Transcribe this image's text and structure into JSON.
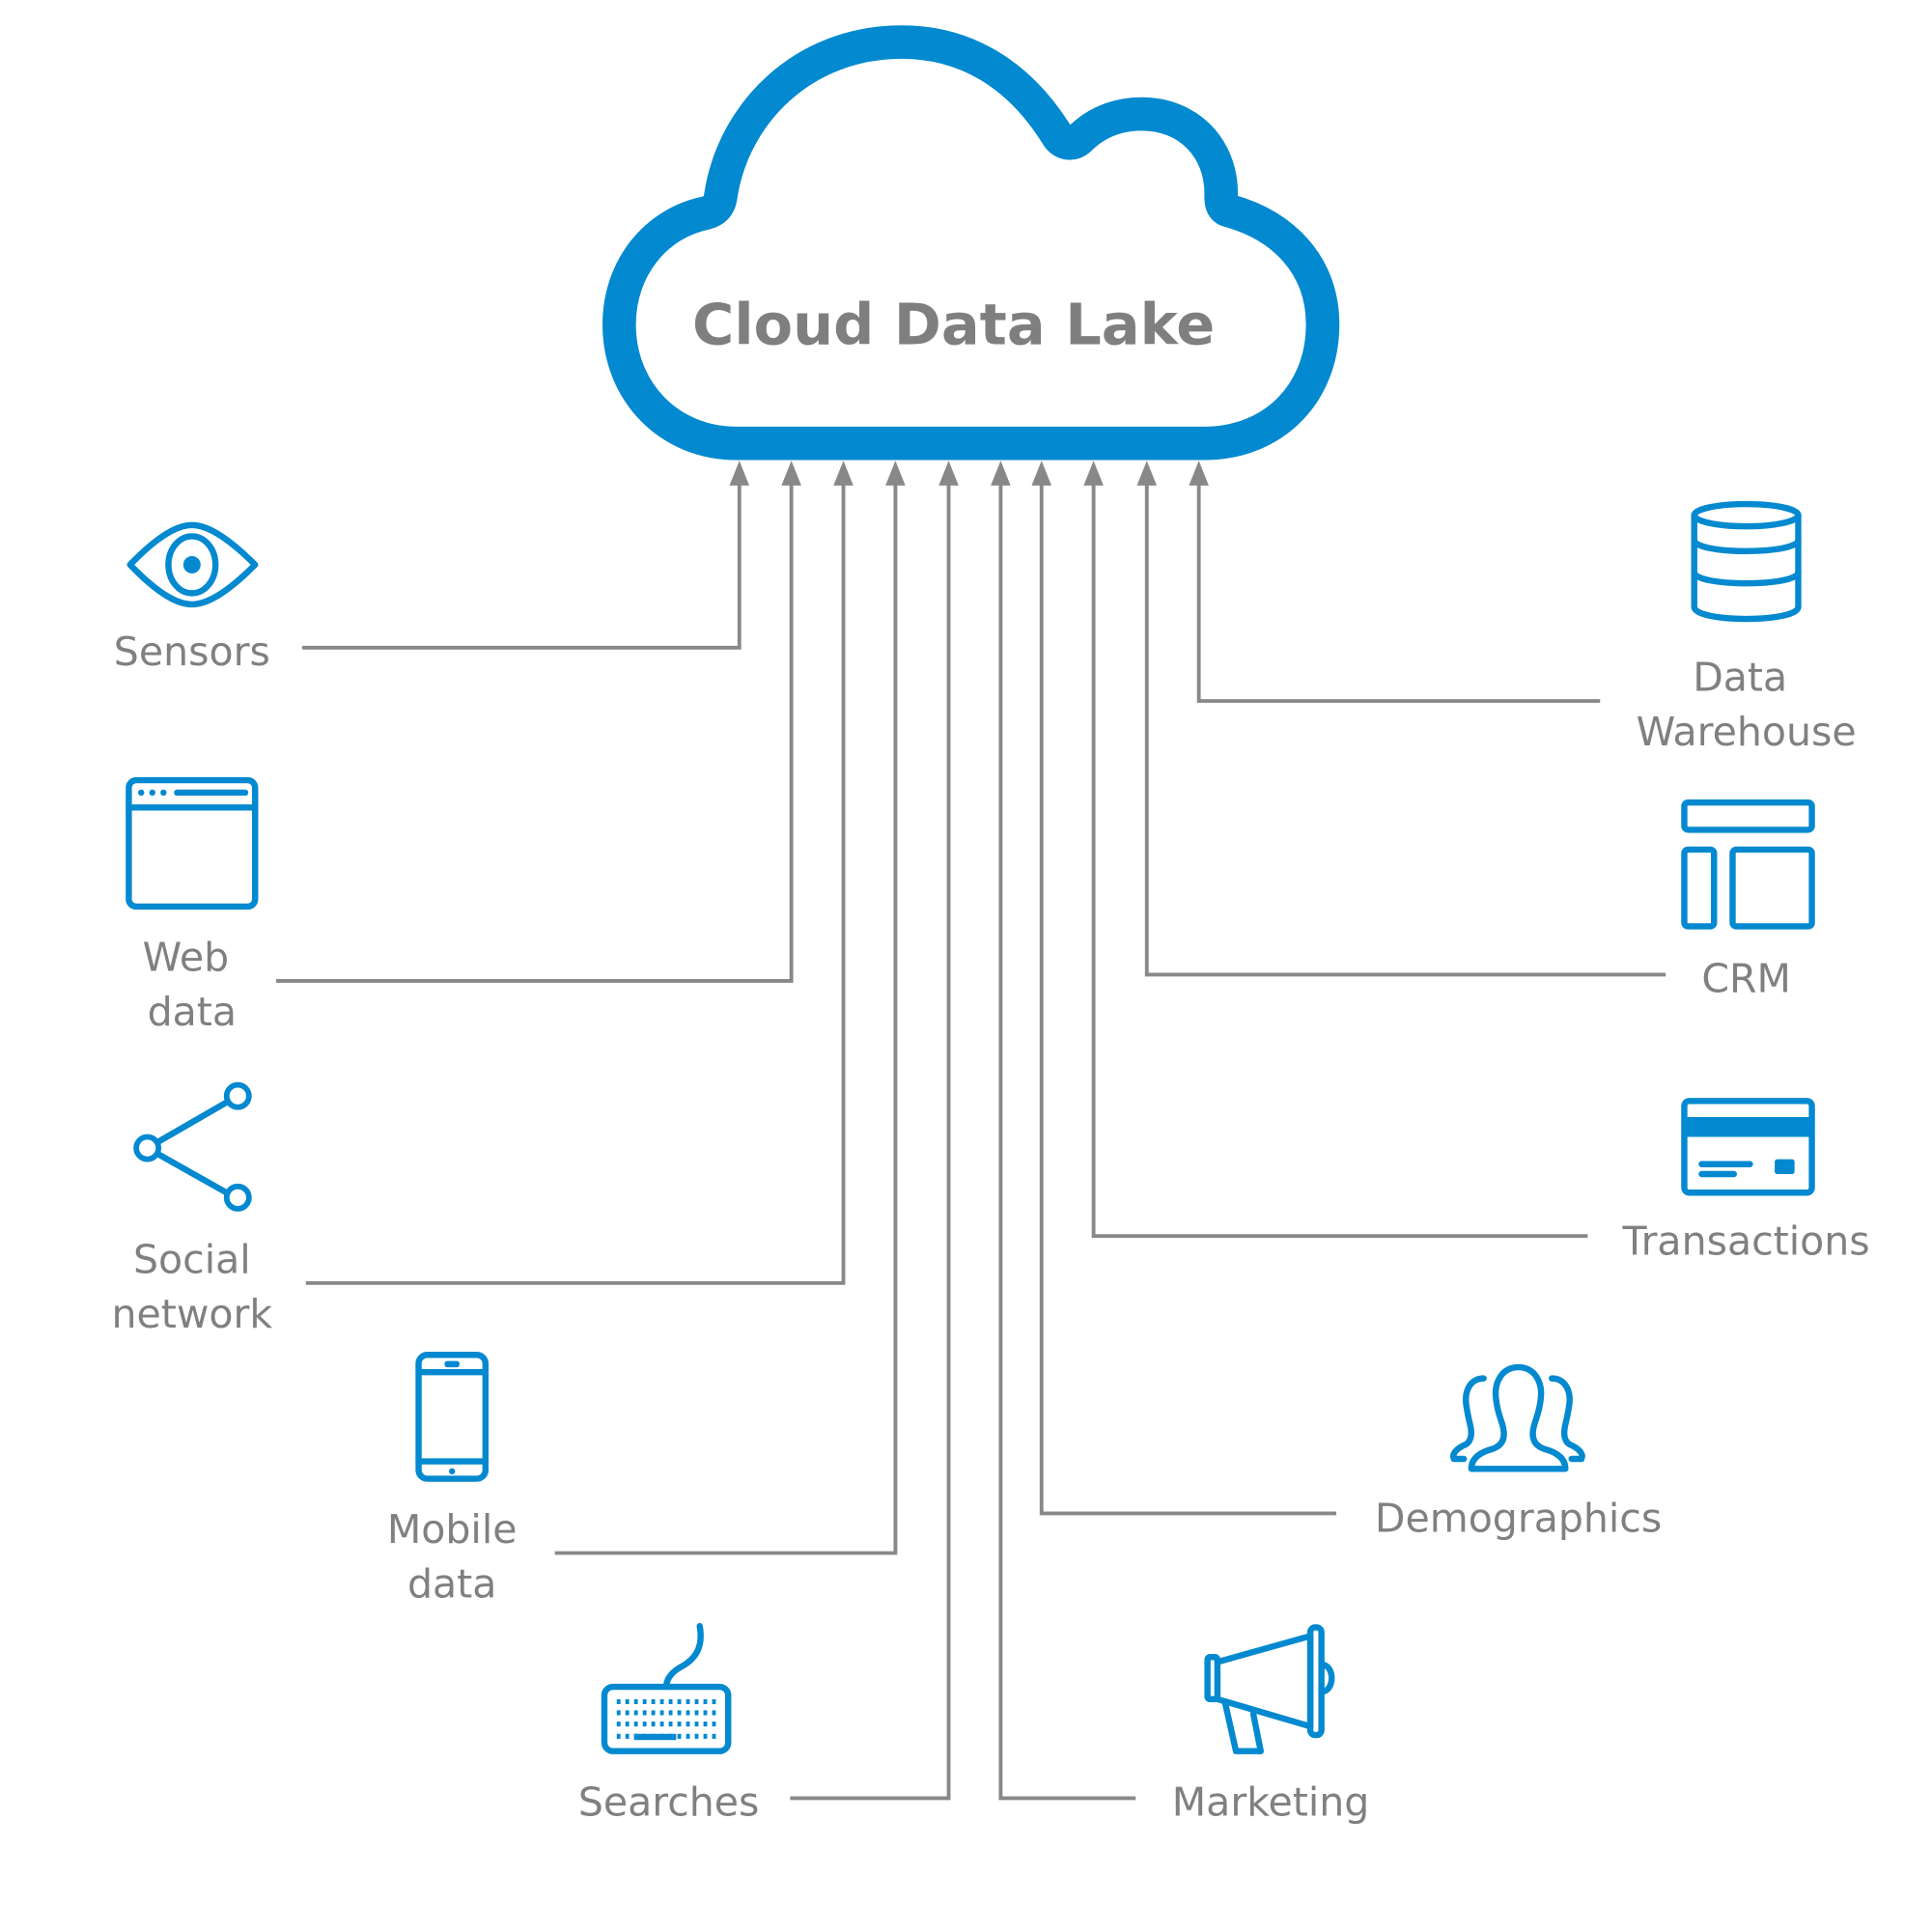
{
  "title": "Cloud Data Lake",
  "colors": {
    "accent": "#0289d0",
    "connector": "#888888",
    "label": "#808080"
  },
  "sources_left": [
    {
      "id": "sensors",
      "icon": "eye-icon",
      "lines": [
        "Sensors"
      ]
    },
    {
      "id": "web-data",
      "icon": "browser-window-icon",
      "lines": [
        "Web",
        "data"
      ]
    },
    {
      "id": "social-network",
      "icon": "share-icon",
      "lines": [
        "Social",
        "network"
      ]
    },
    {
      "id": "mobile-data",
      "icon": "smartphone-icon",
      "lines": [
        "Mobile",
        "data"
      ]
    },
    {
      "id": "searches",
      "icon": "keyboard-icon",
      "lines": [
        "Searches"
      ]
    }
  ],
  "sources_right": [
    {
      "id": "data-warehouse",
      "icon": "database-icon",
      "lines": [
        "Data",
        "Warehouse"
      ]
    },
    {
      "id": "crm",
      "icon": "layout-icon",
      "lines": [
        "CRM"
      ]
    },
    {
      "id": "transactions",
      "icon": "credit-card-icon",
      "lines": [
        "Transactions"
      ]
    },
    {
      "id": "demographics",
      "icon": "people-group-icon",
      "lines": [
        "Demographics"
      ]
    },
    {
      "id": "marketing",
      "icon": "megaphone-icon",
      "lines": [
        "Marketing"
      ]
    }
  ]
}
